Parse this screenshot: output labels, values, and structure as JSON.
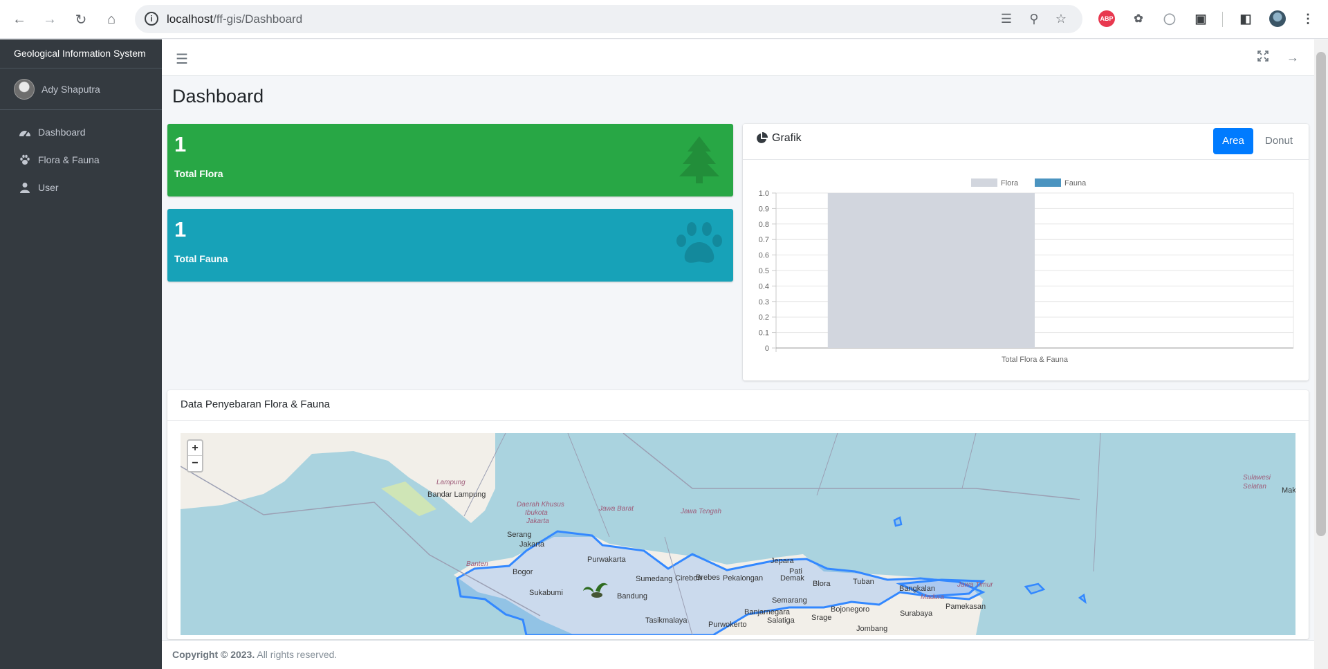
{
  "browser": {
    "url_host": "localhost",
    "url_path": "/ff-gis/Dashboard",
    "extensions": [
      "translate-icon",
      "zoom-icon",
      "star-icon",
      "adblock-icon",
      "bug-icon",
      "timer-icon",
      "puzzle-icon",
      "sidepanel-icon",
      "profile-avatar",
      "kebab-menu-icon"
    ],
    "abp_label": "ABP"
  },
  "sidebar": {
    "brand": "Geological Information System",
    "user": "Ady Shaputra",
    "items": [
      {
        "label": "Dashboard",
        "icon": "tachometer-icon"
      },
      {
        "label": "Flora & Fauna",
        "icon": "paw-icon"
      },
      {
        "label": "User",
        "icon": "user-icon"
      }
    ]
  },
  "page": {
    "title": "Dashboard"
  },
  "stats": {
    "flora": {
      "value": "1",
      "label": "Total Flora",
      "icon": "tree-icon",
      "color": "#28a745"
    },
    "fauna": {
      "value": "1",
      "label": "Total Fauna",
      "icon": "paw-icon",
      "color": "#17a2b8"
    }
  },
  "chart_card": {
    "title": "Grafik",
    "tabs": [
      "Area",
      "Donut"
    ],
    "active_tab": "Area"
  },
  "chart_data": {
    "type": "bar",
    "categories": [
      "Total Flora & Fauna"
    ],
    "series": [
      {
        "name": "Flora",
        "values": [
          1
        ],
        "color": "#d2d6de"
      },
      {
        "name": "Fauna",
        "values": [
          0
        ],
        "color": "#4b94c0"
      }
    ],
    "ylim": [
      0,
      1.0
    ],
    "yticks": [
      "0",
      "0.1",
      "0.2",
      "0.3",
      "0.4",
      "0.5",
      "0.6",
      "0.7",
      "0.8",
      "0.9",
      "1.0"
    ],
    "legend": "top-center",
    "grid": true
  },
  "map_card": {
    "title": "Data Penyebaran Flora & Fauna",
    "zoom_in": "+",
    "zoom_out": "−",
    "labels": [
      {
        "text": "Lampung",
        "style": "region"
      },
      {
        "text": "Bandar Lampung",
        "style": "city"
      },
      {
        "text": "Daerah Khusus",
        "style": "region"
      },
      {
        "text": "Ibukota",
        "style": "region"
      },
      {
        "text": "Jakarta",
        "style": "region"
      },
      {
        "text": "Jawa Barat",
        "style": "region"
      },
      {
        "text": "Jawa Tengah",
        "style": "region"
      },
      {
        "text": "Sulawesi",
        "style": "region"
      },
      {
        "text": "Selatan",
        "style": "region"
      },
      {
        "text": "Mak",
        "style": "city"
      },
      {
        "text": "Serang",
        "style": "city"
      },
      {
        "text": "Banten",
        "style": "region"
      },
      {
        "text": "Jakarta",
        "style": "city"
      },
      {
        "text": "Purwakarta",
        "style": "city"
      },
      {
        "text": "Bogor",
        "style": "city"
      },
      {
        "text": "Sumedang",
        "style": "city"
      },
      {
        "text": "Sukabumi",
        "style": "city"
      },
      {
        "text": "Bandung",
        "style": "city"
      },
      {
        "text": "Cirebon",
        "style": "city"
      },
      {
        "text": "Brebes",
        "style": "city"
      },
      {
        "text": "Pekalongan",
        "style": "city"
      },
      {
        "text": "Jepara",
        "style": "city"
      },
      {
        "text": "Pati",
        "style": "city"
      },
      {
        "text": "Demak",
        "style": "city"
      },
      {
        "text": "Blora",
        "style": "city"
      },
      {
        "text": "Tuban",
        "style": "city"
      },
      {
        "text": "Bangkalan",
        "style": "city"
      },
      {
        "text": "Jawa Timur",
        "style": "region"
      },
      {
        "text": "Madura",
        "style": "region"
      },
      {
        "text": "Pamekasan",
        "style": "city"
      },
      {
        "text": "Semarang",
        "style": "city"
      },
      {
        "text": "Banjarnegara",
        "style": "city"
      },
      {
        "text": "Bojonegoro",
        "style": "city"
      },
      {
        "text": "Surabaya",
        "style": "city"
      },
      {
        "text": "Tasikmalaya",
        "style": "city"
      },
      {
        "text": "Purwokerto",
        "style": "city"
      },
      {
        "text": "Salatiga",
        "style": "city"
      },
      {
        "text": "Srage",
        "style": "city"
      },
      {
        "text": "Jombang",
        "style": "city"
      }
    ],
    "marker": "flora-fauna-marker"
  },
  "footer": {
    "copyright": "Copyright © 2023.",
    "rights": "All rights reserved."
  }
}
